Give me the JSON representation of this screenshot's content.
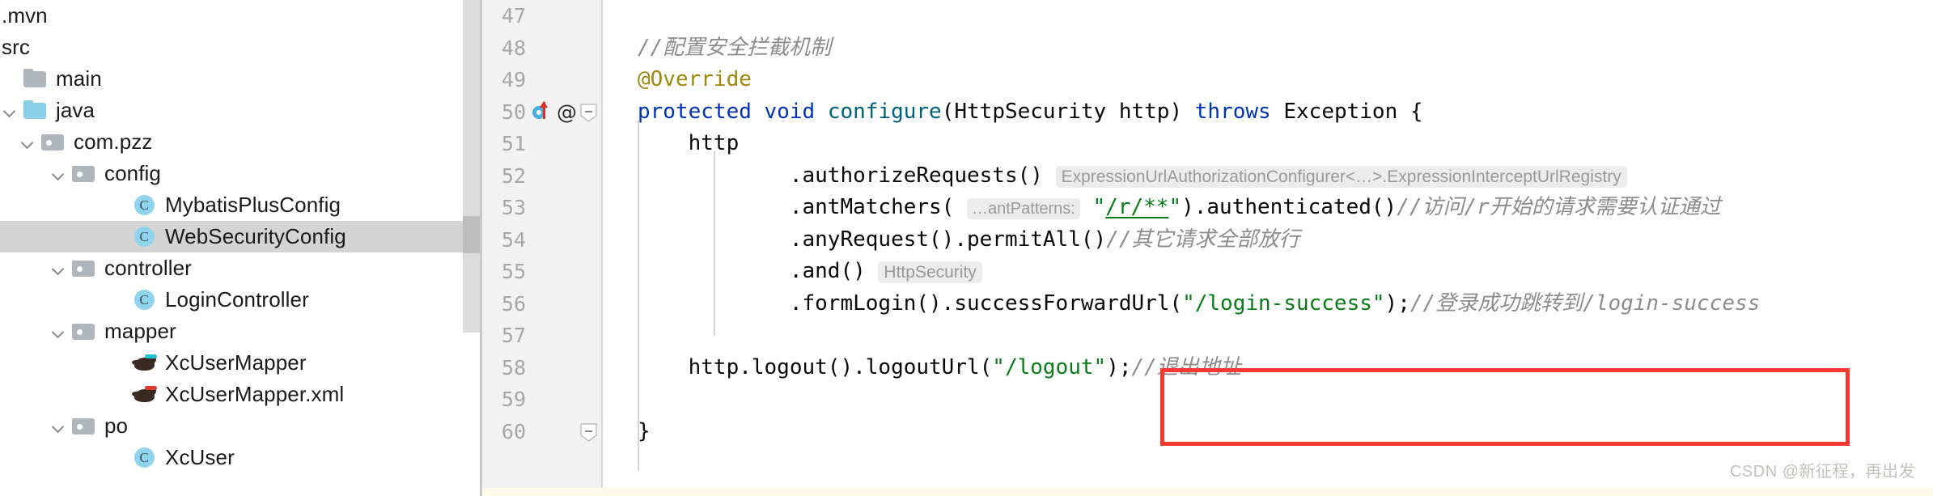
{
  "project_tree": {
    "scrollbar": {
      "present": true
    },
    "items": [
      {
        "label": ".mvn",
        "icon": "none",
        "indent": 0,
        "arrow": false,
        "selected": false,
        "clipped": true
      },
      {
        "label": "src",
        "icon": "none",
        "indent": 0,
        "arrow": false,
        "selected": false,
        "clipped": true
      },
      {
        "label": "main",
        "icon": "folder",
        "indent": 0,
        "arrow": false,
        "selected": false
      },
      {
        "label": "java",
        "icon": "folder-src",
        "indent": 0,
        "arrow": true,
        "selected": false
      },
      {
        "label": "com.pzz",
        "icon": "package",
        "indent": 1,
        "arrow": true,
        "selected": false
      },
      {
        "label": "config",
        "icon": "package",
        "indent": 2,
        "arrow": true,
        "selected": false
      },
      {
        "label": "MybatisPlusConfig",
        "icon": "class",
        "indent": 4,
        "arrow": false,
        "selected": false
      },
      {
        "label": "WebSecurityConfig",
        "icon": "class",
        "indent": 4,
        "arrow": false,
        "selected": true
      },
      {
        "label": "controller",
        "icon": "package",
        "indent": 2,
        "arrow": true,
        "selected": false
      },
      {
        "label": "LoginController",
        "icon": "class",
        "indent": 4,
        "arrow": false,
        "selected": false
      },
      {
        "label": "mapper",
        "icon": "package",
        "indent": 2,
        "arrow": true,
        "selected": false
      },
      {
        "label": "XcUserMapper",
        "icon": "mapper-cyan",
        "indent": 4,
        "arrow": false,
        "selected": false
      },
      {
        "label": "XcUserMapper.xml",
        "icon": "mapper-red",
        "indent": 4,
        "arrow": false,
        "selected": false
      },
      {
        "label": "po",
        "icon": "package",
        "indent": 2,
        "arrow": true,
        "selected": false
      },
      {
        "label": "XcUser",
        "icon": "class",
        "indent": 4,
        "arrow": false,
        "selected": false
      }
    ]
  },
  "editor": {
    "line_numbers": [
      "47",
      "48",
      "49",
      "50",
      "51",
      "52",
      "53",
      "54",
      "55",
      "56",
      "57",
      "58",
      "59",
      "60"
    ],
    "gutter": {
      "override_line": "50",
      "annotation_glyph": "@",
      "fold_lines": [
        "50",
        "60"
      ]
    },
    "lines": [
      {
        "n": "47",
        "segments": []
      },
      {
        "n": "48",
        "segments": [
          {
            "t": "//配置安全拦截机制",
            "c": "cmt"
          }
        ],
        "indent": 1
      },
      {
        "n": "49",
        "segments": [
          {
            "t": "@Override",
            "c": "anno"
          }
        ],
        "indent": 1
      },
      {
        "n": "50",
        "segments": [
          {
            "t": "protected void ",
            "c": "kw"
          },
          {
            "t": "configure",
            "c": "method"
          },
          {
            "t": "(HttpSecurity http) ",
            "c": "plain"
          },
          {
            "t": "throws ",
            "c": "kw"
          },
          {
            "t": "Exception {",
            "c": "plain"
          }
        ],
        "indent": 1
      },
      {
        "n": "51",
        "segments": [
          {
            "t": "    http",
            "c": "plain"
          }
        ],
        "indent": 1
      },
      {
        "n": "52",
        "segments": [
          {
            "t": "            .authorizeRequests() ",
            "c": "plain"
          },
          {
            "t": "ExpressionUrlAuthorizationConfigurer<…>.ExpressionInterceptUrlRegistry",
            "c": "hint"
          }
        ],
        "indent": 1
      },
      {
        "n": "53",
        "segments": [
          {
            "t": "            .antMatchers(",
            "c": "plain"
          },
          {
            "t": " ",
            "c": "plain"
          },
          {
            "t": "…antPatterns:",
            "c": "hint-param"
          },
          {
            "t": " ",
            "c": "plain"
          },
          {
            "t": "\"",
            "c": "str"
          },
          {
            "t": "/r/**",
            "c": "str-link"
          },
          {
            "t": "\"",
            "c": "str"
          },
          {
            "t": ").authenticated()",
            "c": "plain"
          },
          {
            "t": "//访问/r开始的请求需要认证通过",
            "c": "cmt"
          }
        ],
        "indent": 1
      },
      {
        "n": "54",
        "segments": [
          {
            "t": "            .anyRequest().permitAll()",
            "c": "plain"
          },
          {
            "t": "//其它请求全部放行",
            "c": "cmt"
          }
        ],
        "indent": 1
      },
      {
        "n": "55",
        "segments": [
          {
            "t": "            .and() ",
            "c": "plain"
          },
          {
            "t": "HttpSecurity",
            "c": "hint"
          }
        ],
        "indent": 1
      },
      {
        "n": "56",
        "segments": [
          {
            "t": "            .formLogin().successForwardUrl(",
            "c": "plain"
          },
          {
            "t": "\"/login-success\"",
            "c": "str"
          },
          {
            "t": ");",
            "c": "plain"
          },
          {
            "t": "//登录成功跳转到/login-success",
            "c": "cmt"
          }
        ],
        "indent": 1
      },
      {
        "n": "57",
        "segments": []
      },
      {
        "n": "58",
        "segments": [
          {
            "t": "    http.logout().logoutUrl(",
            "c": "plain"
          },
          {
            "t": "\"/logout\"",
            "c": "str"
          },
          {
            "t": ");",
            "c": "plain"
          },
          {
            "t": "//退出地址",
            "c": "cmt"
          }
        ],
        "indent": 1
      },
      {
        "n": "59",
        "segments": []
      },
      {
        "n": "60",
        "segments": [
          {
            "t": "}",
            "c": "plain"
          }
        ],
        "indent": 1
      }
    ],
    "highlight_box": {
      "color": "#f7392f",
      "around_line": "58"
    }
  },
  "watermark": {
    "text": "CSDN @新征程，再出发"
  },
  "colors": {
    "keyword": "#0033b3",
    "method": "#00627a",
    "annotation": "#9e880d",
    "string": "#067d17",
    "comment": "#8c8c8c",
    "selection": "#d4d4d4",
    "gutter_bg": "#f2f2f2",
    "highlight": "#f7392f"
  }
}
